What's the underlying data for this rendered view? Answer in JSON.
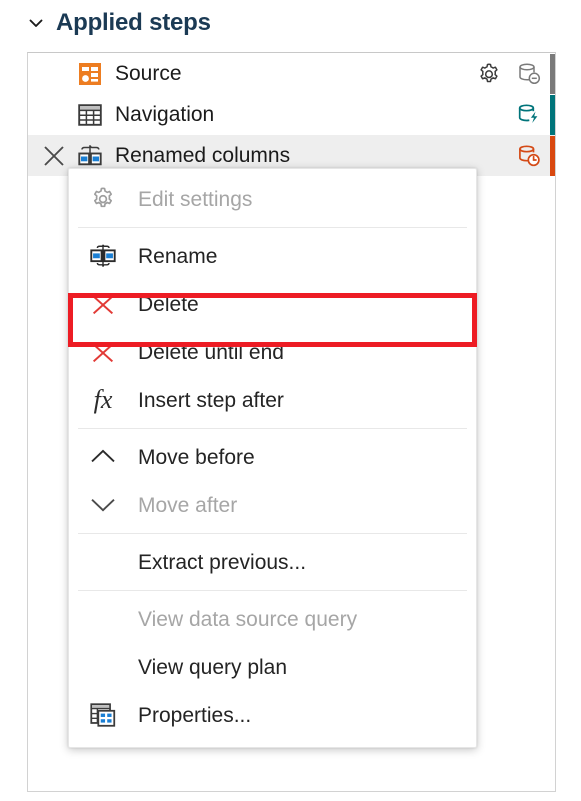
{
  "header": {
    "title": "Applied steps",
    "collapse_icon": "chevron-down-icon"
  },
  "steps_panel": {
    "steps": [
      {
        "label": "Source",
        "icon": "source-step-icon",
        "selected": false,
        "has_delete_x": false,
        "has_gear": true,
        "gear_icon": "gear-icon",
        "db_icon": "database-minus-icon",
        "db_color": "#7a7a7a",
        "status_color": "#7a7a7a"
      },
      {
        "label": "Navigation",
        "icon": "table-step-icon",
        "selected": false,
        "has_delete_x": false,
        "has_gear": false,
        "db_icon": "database-folding-icon",
        "db_color": "#00747a",
        "status_color": "#00747a"
      },
      {
        "label": "Renamed columns",
        "icon": "rename-columns-step-icon",
        "selected": true,
        "has_delete_x": true,
        "has_gear": false,
        "db_icon": "database-clock-icon",
        "db_color": "#d44a16",
        "status_color": "#d9480f"
      }
    ]
  },
  "context_menu": {
    "groups": [
      {
        "items": [
          {
            "label": "Edit settings",
            "icon": "gear-icon",
            "disabled": true
          }
        ]
      },
      {
        "items": [
          {
            "label": "Rename",
            "icon": "rename-icon",
            "disabled": false
          },
          {
            "label": "Delete",
            "icon": "delete-x-icon",
            "disabled": false,
            "highlighted": true
          },
          {
            "label": "Delete until end",
            "icon": "delete-x-icon",
            "disabled": false
          },
          {
            "label": "Insert step after",
            "icon": "fx-icon",
            "disabled": false
          }
        ]
      },
      {
        "items": [
          {
            "label": "Move before",
            "icon": "chevron-up-icon",
            "disabled": false
          },
          {
            "label": "Move after",
            "icon": "chevron-down-icon",
            "disabled": true
          }
        ]
      },
      {
        "items": [
          {
            "label": "Extract previous...",
            "icon": "",
            "disabled": false
          }
        ]
      },
      {
        "items": [
          {
            "label": "View data source query",
            "icon": "",
            "disabled": true
          },
          {
            "label": "View query plan",
            "icon": "",
            "disabled": false
          },
          {
            "label": "Properties...",
            "icon": "properties-icon",
            "disabled": false
          }
        ]
      }
    ]
  },
  "colors": {
    "highlight_red": "#ed1c24",
    "title_blue": "#1b3a54",
    "source_orange": "#ed7d21",
    "accent_blue": "#1a7fd4",
    "delete_red": "#e23a36",
    "selected_row_gray": "#eeeeee"
  }
}
